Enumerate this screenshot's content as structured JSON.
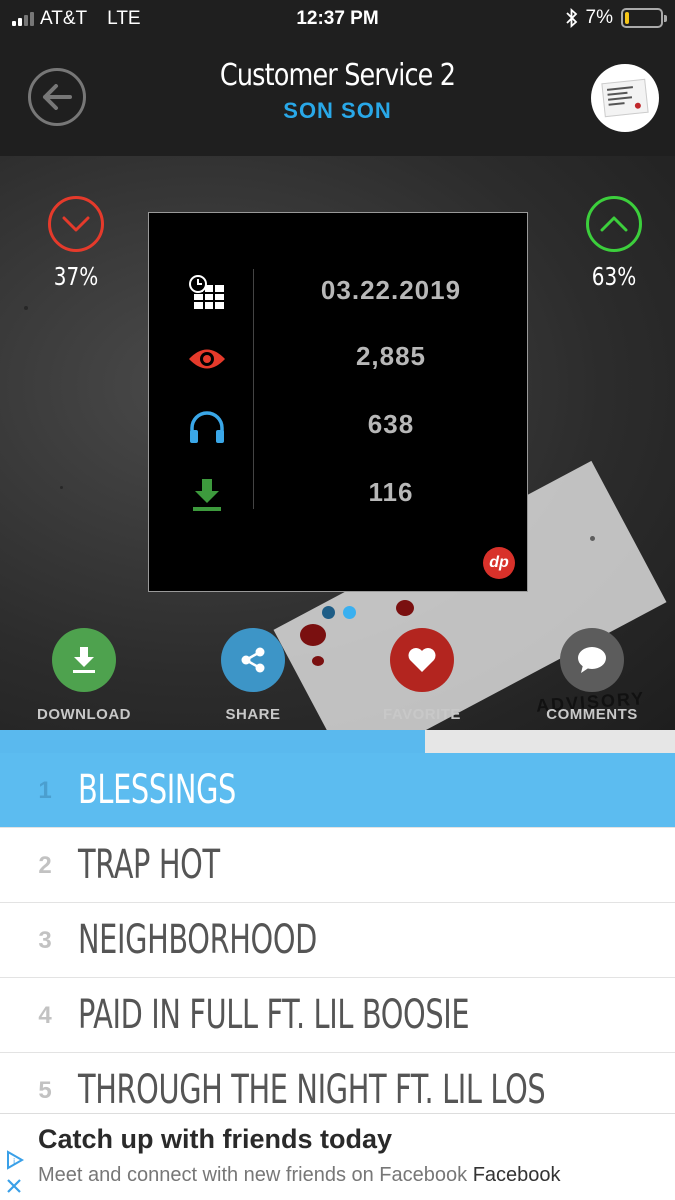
{
  "status_bar": {
    "carrier": "AT&T",
    "network": "LTE",
    "time": "12:37 PM",
    "battery": "7%",
    "battery_level": 0.07,
    "signal_bars_on": 2,
    "signal_bars_total": 4
  },
  "header": {
    "title": "Customer Service 2",
    "artist": "SON SON",
    "artist_color": "#29a8e8"
  },
  "votes": {
    "down_pct": "37%",
    "up_pct": "63%",
    "down_color": "#e53a2b",
    "up_color": "#3ccf3c"
  },
  "stats": {
    "date": "03.22.2019",
    "views": "2,885",
    "plays": "638",
    "downloads": "116",
    "badge": "dp"
  },
  "carousel": {
    "pages": 2,
    "active": 2
  },
  "actions": {
    "download": "DOWNLOAD",
    "share": "SHARE",
    "favorite": "FAVORITE",
    "comments": "COMMENTS"
  },
  "cover_art_text": "ADVISORY",
  "progress": {
    "fraction": 0.63
  },
  "tracks": [
    {
      "number": "1",
      "title": "BLESSINGS",
      "active": true
    },
    {
      "number": "2",
      "title": "TRAP HOT",
      "active": false
    },
    {
      "number": "3",
      "title": "NEIGHBORHOOD",
      "active": false
    },
    {
      "number": "4",
      "title": "PAID IN FULL FT. LIL BOOSIE",
      "active": false
    },
    {
      "number": "5",
      "title": "THROUGH THE NIGHT FT. LIL LOS",
      "active": false
    }
  ],
  "ad": {
    "headline": "Catch up with friends today",
    "body": "Meet and connect with new friends on Facebook",
    "brand": "Facebook"
  }
}
